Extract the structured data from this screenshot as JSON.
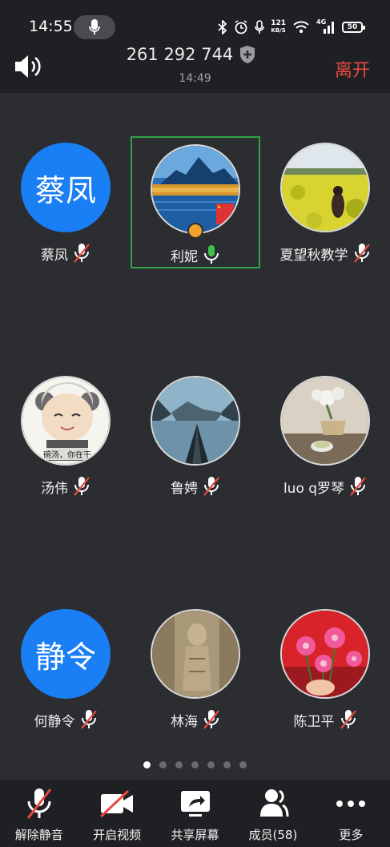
{
  "status_bar": {
    "time": "14:55",
    "net_speed_value": "121",
    "net_speed_unit": "KB/S",
    "network": "4G",
    "battery": "50"
  },
  "header": {
    "meeting_id": "261 292 744",
    "meeting_time": "14:49",
    "leave_label": "离开"
  },
  "participants": [
    {
      "name": "蔡凤",
      "avatar_text": "蔡凤",
      "mic": "muted"
    },
    {
      "name": "利妮",
      "mic": "on",
      "active": true
    },
    {
      "name": "夏望秋教学",
      "mic": "muted"
    },
    {
      "name": "汤伟",
      "mic": "muted",
      "avatar_caption": "碗汤，你在干"
    },
    {
      "name": "鲁娉",
      "mic": "muted"
    },
    {
      "name": "luo q罗琴",
      "mic": "muted"
    },
    {
      "name": "何静令",
      "avatar_text": "静令",
      "mic": "muted"
    },
    {
      "name": "林海",
      "mic": "muted"
    },
    {
      "name": "陈卫平",
      "mic": "muted"
    }
  ],
  "pager": {
    "total": 7,
    "current": 1
  },
  "toolbar": {
    "unmute": "解除静音",
    "start_video": "开启视频",
    "share_screen": "共享屏幕",
    "members": "成员(58)",
    "more": "更多"
  },
  "colors": {
    "background": "#2b2d30",
    "bar": "#1f2023",
    "avatar_blue": "#1a7ef5",
    "active_border": "#2fa346",
    "mic_on": "#3fc14f",
    "muted_slash": "#e84a3f",
    "leave": "#e84a3f"
  }
}
